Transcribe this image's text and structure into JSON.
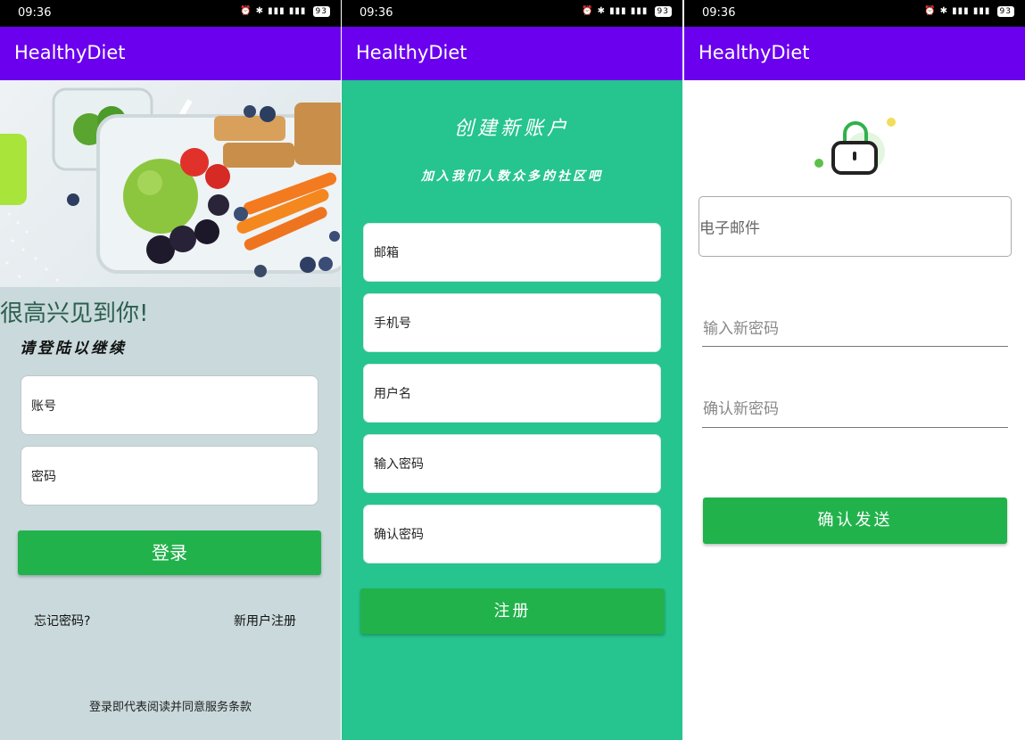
{
  "status": {
    "time": "09:36",
    "battery": "93"
  },
  "app": {
    "title": "HealthyDiet"
  },
  "login": {
    "greeting": "很高兴见到你!",
    "subtitle": "请登陆以继续",
    "account_placeholder": "账号",
    "password_placeholder": "密码",
    "login_button": "登录",
    "forgot_link": "忘记密码?",
    "register_link": "新用户注册",
    "terms": "登录即代表阅读并同意服务条款"
  },
  "register": {
    "title": "创建新账户",
    "subtitle": "加入我们人数众多的社区吧",
    "fields": [
      "邮箱",
      "手机号",
      "用户名",
      "输入密码",
      "确认密码"
    ],
    "submit_button": "注册"
  },
  "reset": {
    "email_placeholder": "电子邮件",
    "new_password_placeholder": "输入新密码",
    "confirm_password_placeholder": "确认新密码",
    "send_button": "确认发送"
  },
  "colors": {
    "appbar": "#6a00ee",
    "button": "#22b24c",
    "register_bg": "#26c48f",
    "login_bg": "#c9d9dc"
  }
}
